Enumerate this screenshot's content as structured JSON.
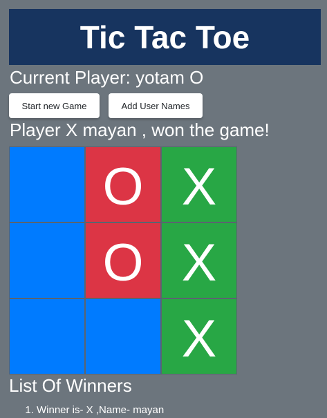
{
  "header": {
    "title": "Tic Tac Toe"
  },
  "current_player": "Current Player: yotam O",
  "buttons": {
    "start_new_game": "Start new Game",
    "add_user_names": "Add User Names"
  },
  "status": "Player X mayan , won the game!",
  "board": [
    [
      "",
      "O",
      "X"
    ],
    [
      "",
      "O",
      "X"
    ],
    [
      "",
      "",
      "X"
    ]
  ],
  "winners": {
    "title": "List Of Winners",
    "items": [
      "Winner is- X ,Name- mayan"
    ]
  },
  "colors": {
    "background": "#6c757d",
    "header": "#17345f",
    "empty_cell": "#007bff",
    "o_cell": "#dc3545",
    "x_cell": "#28a745"
  }
}
